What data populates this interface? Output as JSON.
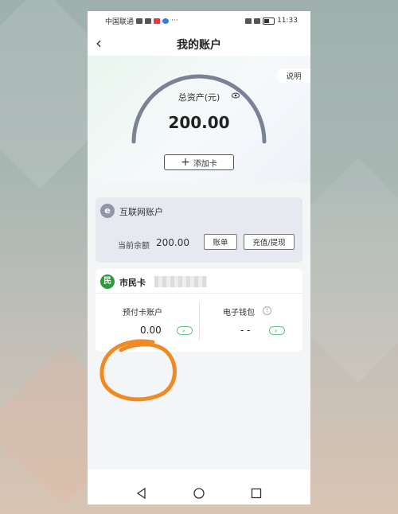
{
  "status_bar": {
    "carrier": "中国联通",
    "time": "11:33"
  },
  "header": {
    "title": "我的账户",
    "back_icon": "chevron-left-icon"
  },
  "asset": {
    "explain_label": "说明",
    "label": "总资产(元)",
    "value": "200.00",
    "eye_icon": "eye-icon",
    "add_card_label": "添加卡"
  },
  "internet_account": {
    "logo_letter": "e",
    "title": "互联网账户",
    "balance_label": "当前余额",
    "balance_value": "200.00",
    "bill_button": "账单",
    "recharge_button": "充值/提现"
  },
  "citizen_card": {
    "logo_letter": "民",
    "title": "市民卡",
    "prepaid_label": "预付卡账户",
    "prepaid_value": "0.00",
    "wallet_label": "电子钱包",
    "wallet_value": "- -"
  },
  "colors": {
    "accent_green": "#2e9a3e",
    "annotation_orange": "#f08a24",
    "gauge_grey": "#7a8296"
  },
  "bottom_nav": {
    "icons": [
      "back-triangle-icon",
      "home-circle-icon",
      "recent-square-icon"
    ]
  }
}
